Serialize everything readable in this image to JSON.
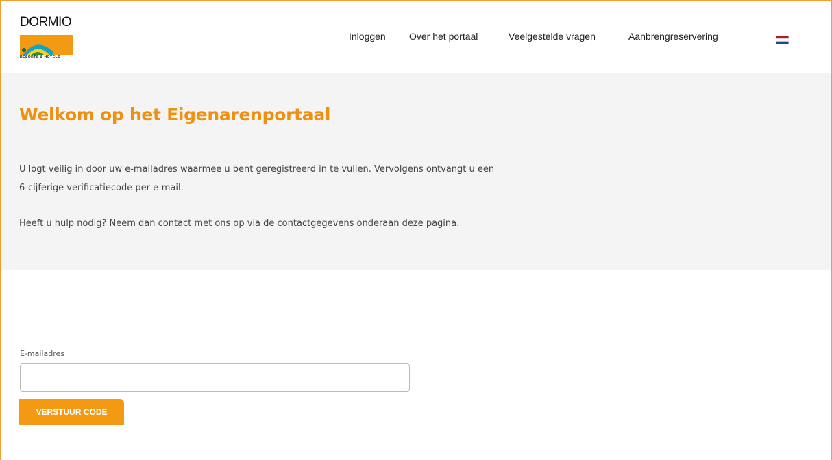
{
  "brand": {
    "name": "DORMIO",
    "tagline": "RESORTS & HOTELS",
    "accent": "#f0900f",
    "button_color": "#f39a12"
  },
  "nav": {
    "items": [
      {
        "label": "Inloggen"
      },
      {
        "label": "Over het portaal"
      },
      {
        "label": "Veelgestelde vragen"
      },
      {
        "label": "Aanbrengreservering"
      }
    ],
    "language_icon": "dutch-flag-icon"
  },
  "hero": {
    "title": "Welkom op het Eigenarenportaal",
    "paragraph1_line1": "U logt veilig in door uw e-mailadres waarmee u bent geregistreerd in te vullen. Vervolgens ontvangt u een",
    "paragraph1_line2": "6-cijferige verificatiecode per e-mail.",
    "paragraph2": "Heeft u hulp nodig? Neem dan contact met ons op via de contactgegevens onderaan deze pagina."
  },
  "form": {
    "email_label": "E-mailadres",
    "email_value": "",
    "email_placeholder": "",
    "submit_label": "VERSTUUR CODE"
  }
}
